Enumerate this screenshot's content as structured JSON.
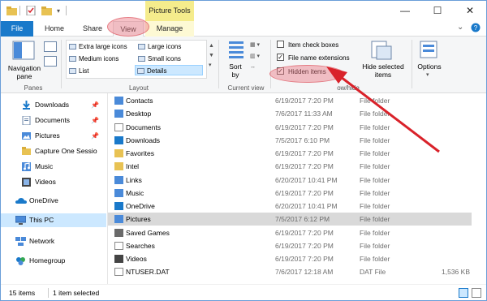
{
  "window": {
    "contextual_tab_group": "Picture Tools",
    "minimize_glyph": "—",
    "maximize_glyph": "☐",
    "close_glyph": "✕"
  },
  "tabs": {
    "file": "File",
    "home": "Home",
    "share": "Share",
    "view": "View",
    "manage": "Manage"
  },
  "ribbon": {
    "panes": {
      "navigation_pane_label": "Navigation\npane",
      "group_label": "Panes"
    },
    "layout": {
      "items": [
        "Extra large icons",
        "Large icons",
        "Medium icons",
        "Small icons",
        "List",
        "Details"
      ],
      "selected": "Details",
      "group_label": "Layout"
    },
    "current_view": {
      "sort_label": "Sort\nby",
      "group_label": "Current view"
    },
    "show_hide": {
      "item_check_boxes": "Item check boxes",
      "file_name_extensions": "File name extensions",
      "hidden_items": "Hidden items",
      "item_check_boxes_checked": false,
      "file_name_extensions_checked": true,
      "hidden_items_checked": true,
      "hide_selected_label": "Hide selected\nitems",
      "group_label": "Show/hide",
      "group_label_visible": "ow/hide"
    },
    "options": {
      "label": "Options"
    }
  },
  "nav": {
    "items": [
      {
        "label": "Downloads",
        "icon": "download-arrow-icon",
        "pinned": true
      },
      {
        "label": "Documents",
        "icon": "documents-icon",
        "pinned": true
      },
      {
        "label": "Pictures",
        "icon": "pictures-icon",
        "pinned": true
      },
      {
        "label": "Capture One Sessio",
        "icon": "folder-icon",
        "pinned": false
      },
      {
        "label": "Music",
        "icon": "music-icon",
        "pinned": false
      },
      {
        "label": "Videos",
        "icon": "videos-icon",
        "pinned": false
      },
      {
        "label": "OneDrive",
        "icon": "onedrive-cloud-icon",
        "pinned": false
      },
      {
        "label": "This PC",
        "icon": "this-pc-icon",
        "pinned": false,
        "selected": true
      },
      {
        "label": "Network",
        "icon": "network-icon",
        "pinned": false
      },
      {
        "label": "Homegroup",
        "icon": "homegroup-icon",
        "pinned": false
      }
    ]
  },
  "files": [
    {
      "name": "Contacts",
      "date": "6/19/2017 7:20 PM",
      "type": "File folder",
      "size": "",
      "icon": "contacts-icon"
    },
    {
      "name": "Desktop",
      "date": "7/6/2017 11:33 AM",
      "type": "File folder",
      "size": "",
      "icon": "desktop-folder-icon"
    },
    {
      "name": "Documents",
      "date": "6/19/2017 7:20 PM",
      "type": "File folder",
      "size": "",
      "icon": "documents-icon"
    },
    {
      "name": "Downloads",
      "date": "7/5/2017 6:10 PM",
      "type": "File folder",
      "size": "",
      "icon": "download-arrow-icon"
    },
    {
      "name": "Favorites",
      "date": "6/19/2017 7:20 PM",
      "type": "File folder",
      "size": "",
      "icon": "favorites-star-icon"
    },
    {
      "name": "Intel",
      "date": "6/19/2017 7:20 PM",
      "type": "File folder",
      "size": "",
      "icon": "folder-icon"
    },
    {
      "name": "Links",
      "date": "6/20/2017 10:41 PM",
      "type": "File folder",
      "size": "",
      "icon": "links-icon"
    },
    {
      "name": "Music",
      "date": "6/19/2017 7:20 PM",
      "type": "File folder",
      "size": "",
      "icon": "music-icon"
    },
    {
      "name": "OneDrive",
      "date": "6/20/2017 10:41 PM",
      "type": "File folder",
      "size": "",
      "icon": "onedrive-cloud-icon"
    },
    {
      "name": "Pictures",
      "date": "7/5/2017 6:12 PM",
      "type": "File folder",
      "size": "",
      "icon": "pictures-icon",
      "selected": true
    },
    {
      "name": "Saved Games",
      "date": "6/19/2017 7:20 PM",
      "type": "File folder",
      "size": "",
      "icon": "saved-games-icon"
    },
    {
      "name": "Searches",
      "date": "6/19/2017 7:20 PM",
      "type": "File folder",
      "size": "",
      "icon": "searches-icon"
    },
    {
      "name": "Videos",
      "date": "6/19/2017 7:20 PM",
      "type": "File folder",
      "size": "",
      "icon": "videos-icon"
    },
    {
      "name": "NTUSER.DAT",
      "date": "7/6/2017 12:18 AM",
      "type": "DAT File",
      "size": "1,536 KB",
      "icon": "file-icon"
    }
  ],
  "status": {
    "item_count": "15 items",
    "selection": "1 item selected"
  },
  "colors": {
    "file_tab": "#1979ca",
    "picture_tools": "#f5ec8c",
    "annotation": "#d9222a",
    "selection": "#cce8ff"
  }
}
